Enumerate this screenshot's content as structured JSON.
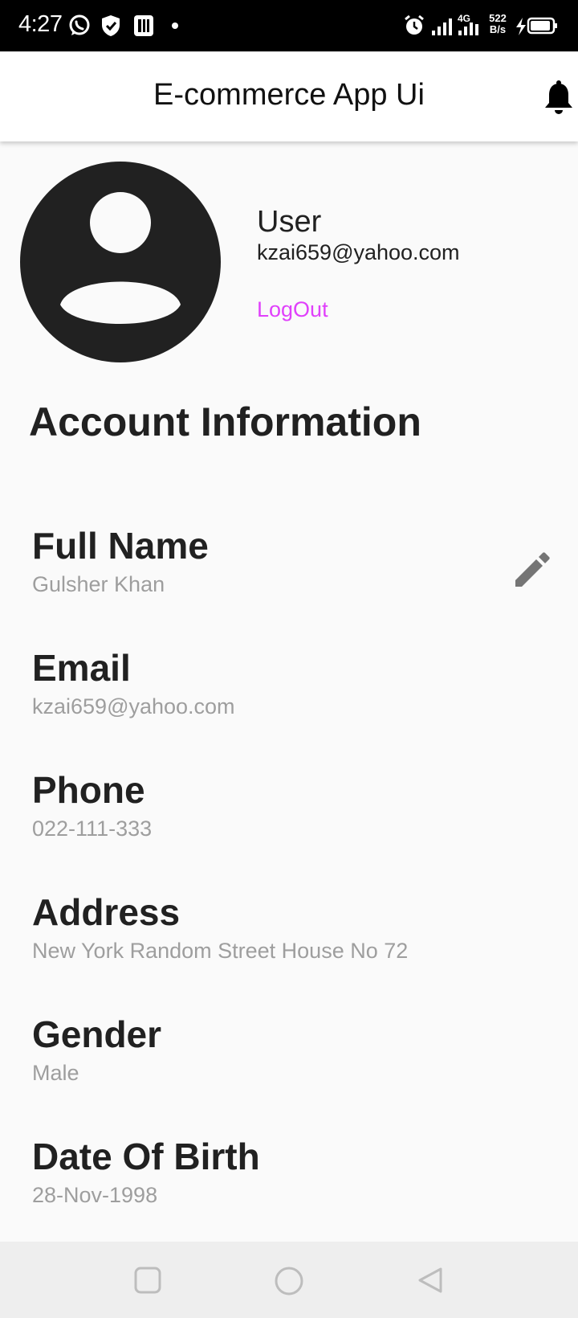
{
  "status_bar": {
    "time": "4:27",
    "network": "4G",
    "speed_value": "522",
    "speed_unit": "B/s",
    "icons": [
      "whatsapp-icon",
      "shield-icon",
      "parking-icon",
      "dot-icon",
      "alarm-icon",
      "signal-icon",
      "signal-icon-2",
      "battery-icon"
    ]
  },
  "app_bar": {
    "title": "E-commerce App Ui",
    "action_icon": "bell-icon"
  },
  "profile": {
    "avatar_icon": "account-circle-icon",
    "name": "User",
    "email": "kzai659@yahoo.com",
    "logout_label": "LogOut",
    "logout_color": "#e040fb"
  },
  "account": {
    "title": "Account Information",
    "edit_icon": "pencil-icon",
    "fields": [
      {
        "label": "Full Name",
        "value": "Gulsher Khan"
      },
      {
        "label": "Email",
        "value": "kzai659@yahoo.com"
      },
      {
        "label": "Phone",
        "value": "022-111-333"
      },
      {
        "label": "Address",
        "value": "New York Random Street House No 72"
      },
      {
        "label": "Gender",
        "value": "Male"
      },
      {
        "label": "Date Of Birth",
        "value": "28-Nov-1998"
      }
    ]
  },
  "nav_bar": {
    "icons": [
      "recents-square-icon",
      "home-circle-icon",
      "back-triangle-icon"
    ]
  }
}
